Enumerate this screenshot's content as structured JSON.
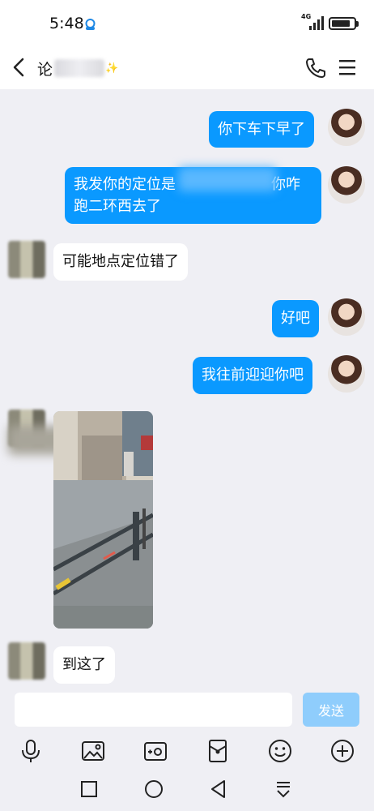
{
  "status_bar": {
    "time": "5:48",
    "network": "4G",
    "battery_level": 0.85
  },
  "header": {
    "title_visible": "论",
    "title_blurred": true
  },
  "messages": [
    {
      "side": "me",
      "text": "你下车下早了"
    },
    {
      "side": "me",
      "line1": "我发你的定位是",
      "line1_tail": "你咋",
      "line2": "跑二环西去了",
      "partially_blurred": true
    },
    {
      "side": "other",
      "text": "可能地点定位错了"
    },
    {
      "side": "me",
      "text": "好吧"
    },
    {
      "side": "me",
      "text": "我往前迎迎你吧"
    },
    {
      "side": "other",
      "type": "image",
      "image_name": "street-photo"
    },
    {
      "side": "other",
      "text": "到这了"
    }
  ],
  "input": {
    "value": "",
    "placeholder": "",
    "send_label": "发送"
  },
  "toolbar": [
    "microphone-icon",
    "image-icon",
    "camera-icon",
    "red-packet-icon",
    "emoji-icon",
    "plus-icon"
  ],
  "nav": [
    "recent-apps-icon",
    "home-icon",
    "back-triangle-icon",
    "notification-pull-icon"
  ],
  "colors": {
    "my_bubble": "#0a99ff",
    "other_bubble": "#ffffff",
    "chat_background": "#efeff4",
    "send_button": "#8fcdfc"
  }
}
